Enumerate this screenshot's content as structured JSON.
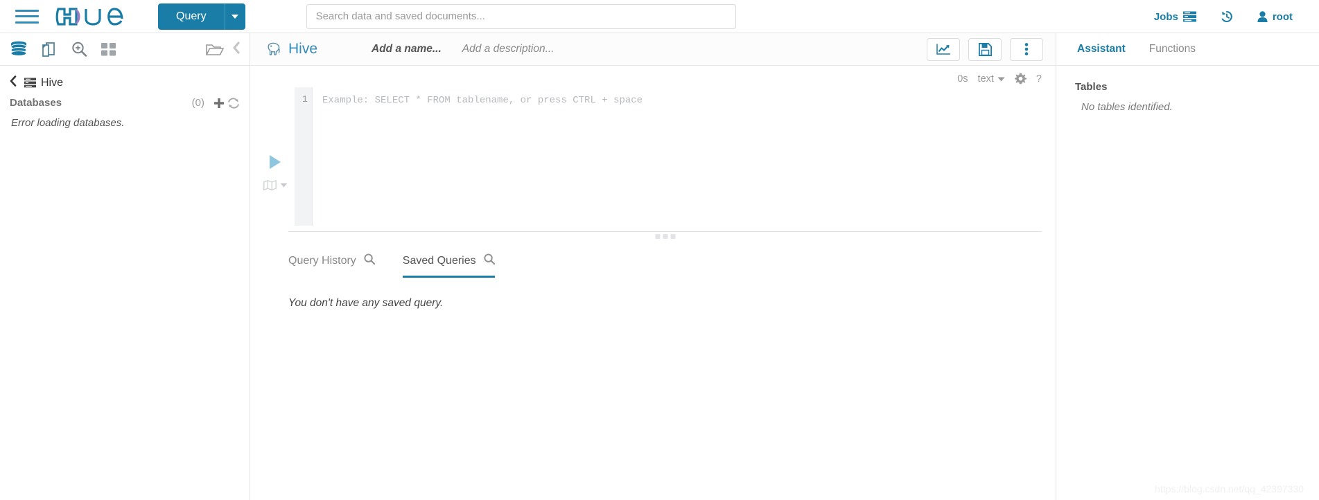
{
  "topnav": {
    "menu_icon": "hamburger-icon",
    "logo_text": "hue",
    "query_button": "Query",
    "query_caret": "chevron-down-icon",
    "search": {
      "placeholder": "Search data and saved documents...",
      "value": ""
    },
    "right": {
      "jobs_label": "Jobs",
      "jobs_icon": "jobs-list-icon",
      "history_icon": "history-clock-icon",
      "user_label": "root",
      "user_icon": "user-icon"
    },
    "accent_color": "#1a7da8"
  },
  "left_panel": {
    "icons": [
      {
        "name": "database-icon",
        "active": true
      },
      {
        "name": "documents-icon",
        "active": false
      },
      {
        "name": "search-zoom-icon",
        "active": false
      },
      {
        "name": "grid-apps-icon",
        "active": false
      }
    ],
    "browse_icon": "folder-open-icon",
    "collapse_icon": "chevron-left-icon",
    "source_back_icon": "chevron-left-icon",
    "source_icon": "hive-source-icon",
    "source_label": "Hive",
    "databases_title": "Databases",
    "databases_count": "(0)",
    "add_icon": "plus-icon",
    "refresh_icon": "refresh-icon",
    "error_message": "Error loading databases."
  },
  "editor": {
    "app_icon": "hive-elephant-icon",
    "app_name": "Hive",
    "name_placeholder": "Add a name...",
    "description_placeholder": "Add a description...",
    "header_buttons": [
      {
        "name": "chart-results-button",
        "icon": "line-chart-icon"
      },
      {
        "name": "save-query-button",
        "icon": "floppy-save-icon"
      },
      {
        "name": "more-options-button",
        "icon": "vertical-dots-icon"
      }
    ],
    "meta": {
      "elapsed": "0s",
      "result_format": "text",
      "format_caret": "chevron-down-icon",
      "settings_icon": "gear-icon",
      "help_icon": "question-mark-icon"
    },
    "run_icon": "play-triangle-icon",
    "explain_icon": "map-book-icon",
    "explain_caret": "chevron-down-icon",
    "line_number": "1",
    "code_placeholder": "Example: SELECT * FROM tablename, or press CTRL + space",
    "drag_handle": "resize-dots-handle"
  },
  "results": {
    "tabs": [
      {
        "label": "Query History",
        "icon": "search-icon",
        "active": false
      },
      {
        "label": "Saved Queries",
        "icon": "search-icon",
        "active": true
      }
    ],
    "empty_message": "You don't have any saved query."
  },
  "assistant": {
    "tabs": [
      {
        "label": "Assistant",
        "active": true
      },
      {
        "label": "Functions",
        "active": false
      }
    ],
    "section_title": "Tables",
    "empty_message": "No tables identified."
  },
  "watermark": "https://blog.csdn.net/qq_42397330"
}
